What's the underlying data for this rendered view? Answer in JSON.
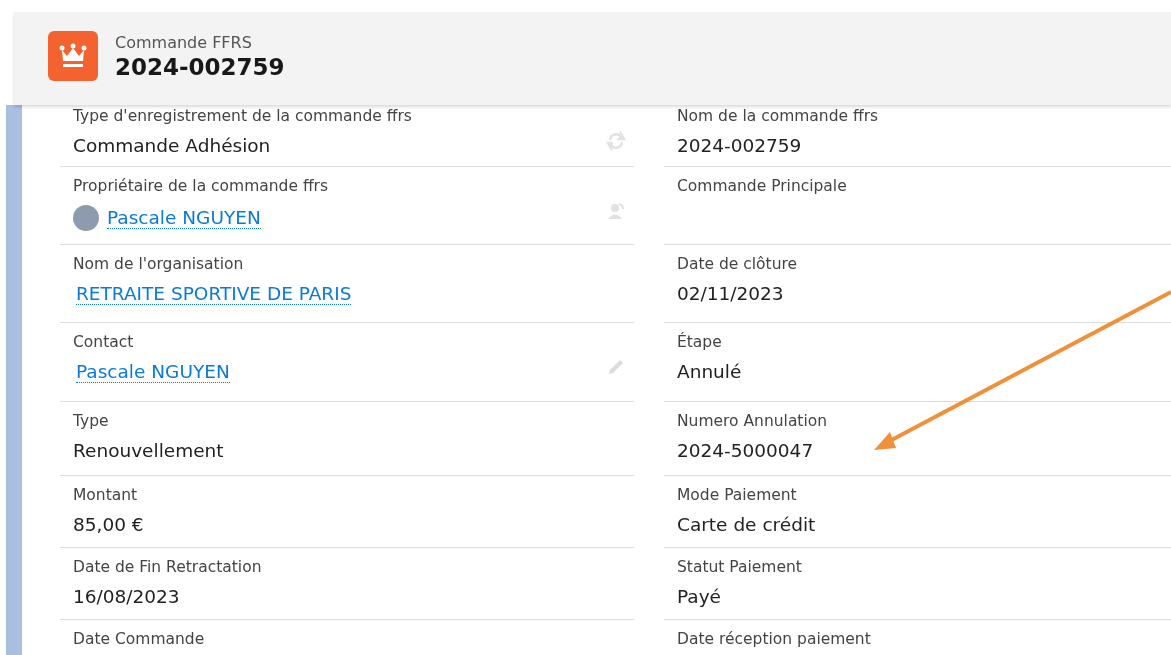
{
  "header": {
    "object_type": "Commande FFRS",
    "record_name": "2024-002759"
  },
  "fields": [
    {
      "label": "Type d'enregistrement de la commande ffrs",
      "value": "Commande Adhésion",
      "kind": "record_type"
    },
    {
      "label": "Nom de la commande ffrs",
      "value": "2024-002759",
      "kind": "text"
    },
    {
      "label": "Propriétaire de la commande ffrs",
      "value": "Pascale NGUYEN",
      "kind": "owner"
    },
    {
      "label": "Commande Principale",
      "kind": "text"
    },
    {
      "label": "Nom de l'organisation",
      "value": "RETRAITE SPORTIVE DE PARIS",
      "kind": "link"
    },
    {
      "label": "Date de clôture",
      "value": "02/11/2023",
      "kind": "text"
    },
    {
      "label": "Contact",
      "value": "Pascale NGUYEN",
      "kind": "editable_link"
    },
    {
      "label": "Étape",
      "value": "Annulé",
      "kind": "text"
    },
    {
      "label": "Type",
      "value": "Renouvellement",
      "kind": "text"
    },
    {
      "label": "Numero Annulation",
      "value": "2024-5000047",
      "kind": "text"
    },
    {
      "label": "Montant",
      "value": "85,00 €",
      "kind": "text"
    },
    {
      "label": "Mode Paiement",
      "value": "Carte de crédit",
      "kind": "text"
    },
    {
      "label": "Date de Fin Retractation",
      "value": "16/08/2023",
      "kind": "text"
    },
    {
      "label": "Statut Paiement",
      "value": "Payé",
      "kind": "text"
    },
    {
      "label": "Date Commande",
      "kind": "text"
    },
    {
      "label": "Date réception paiement",
      "kind": "text"
    }
  ]
}
